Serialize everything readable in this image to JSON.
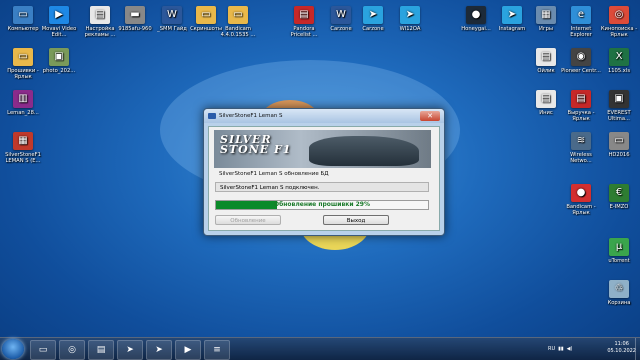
{
  "desktop_icons": [
    {
      "label": "Компьютер",
      "icon": "computer-icon",
      "color": "#3a7fc4",
      "glyph": "▭"
    },
    {
      "label": "Movavi Video Edit...",
      "icon": "movavi-icon",
      "color": "#1e88e5",
      "glyph": "▶"
    },
    {
      "label": "Настройка рекламы ...",
      "icon": "document-icon",
      "color": "#e8e8e8",
      "glyph": "▤"
    },
    {
      "label": "9185afu-960",
      "icon": "usb-icon",
      "color": "#888888",
      "glyph": "▬"
    },
    {
      "label": "_SMM Гайд",
      "icon": "word-icon",
      "color": "#2b579a",
      "glyph": "W"
    },
    {
      "label": "Скриншоты",
      "icon": "folder-icon",
      "color": "#e9b84a",
      "glyph": "▭"
    },
    {
      "label": "Bandicam 4.4.0.1535 ...",
      "icon": "folder-icon",
      "color": "#e9b84a",
      "glyph": "▭"
    },
    {
      "label": "Pandora Pricelist ...",
      "icon": "pdf-icon",
      "color": "#c62828",
      "glyph": "▤"
    },
    {
      "label": "Carzone",
      "icon": "word-icon",
      "color": "#2b579a",
      "glyph": "W"
    },
    {
      "label": "Carzone",
      "icon": "telegram-icon",
      "color": "#2aa3df",
      "glyph": "➤"
    },
    {
      "label": "WI12OA",
      "icon": "telegram-icon",
      "color": "#2aa3df",
      "glyph": "➤"
    },
    {
      "label": "Honeygai...",
      "icon": "honeygain-icon",
      "color": "#1d2a38",
      "glyph": "●"
    },
    {
      "label": "Instagram",
      "icon": "telegram-icon",
      "color": "#2aa3df",
      "glyph": "➤"
    },
    {
      "label": "Игры",
      "icon": "games-icon",
      "color": "#6a8caf",
      "glyph": "▦"
    },
    {
      "label": "Internet Explorer",
      "icon": "ie-icon",
      "color": "#2f8fd8",
      "glyph": "e"
    },
    {
      "label": "Кинопоиска - Ярлык",
      "icon": "chrome-icon",
      "color": "#dd4b39",
      "glyph": "◎"
    },
    {
      "label": "Прошивки - Ярлык",
      "icon": "folder-icon",
      "color": "#e9b84a",
      "glyph": "▭"
    },
    {
      "label": "photo_202...",
      "icon": "image-icon",
      "color": "#7a9a5a",
      "glyph": "▣"
    },
    {
      "label": "Ойлик",
      "icon": "document-icon",
      "color": "#e8e8e8",
      "glyph": "▤"
    },
    {
      "label": "Pioneer Centr...",
      "icon": "pioneer-icon",
      "color": "#444444",
      "glyph": "◉"
    },
    {
      "label": "1105.xls",
      "icon": "excel-icon",
      "color": "#1f7244",
      "glyph": "X"
    },
    {
      "label": "Leman_28...",
      "icon": "winrar-icon",
      "color": "#8b2b8b",
      "glyph": "▥"
    },
    {
      "label": "Инис",
      "icon": "document-icon",
      "color": "#e8e8e8",
      "glyph": "▤"
    },
    {
      "label": "Выручка - Ярлык",
      "icon": "pdf-icon",
      "color": "#c62828",
      "glyph": "▤"
    },
    {
      "label": "EVEREST Ultima...",
      "icon": "everest-icon",
      "color": "#333333",
      "glyph": "▣"
    },
    {
      "label": "SilverStoneF1 LEMAN S (E...",
      "icon": "silverstone-icon",
      "color": "#c0392b",
      "glyph": "▦"
    },
    {
      "label": "Wireless Netwo...",
      "icon": "wireless-icon",
      "color": "#4a6a8a",
      "glyph": "≋"
    },
    {
      "label": "HD2016",
      "icon": "hd-icon",
      "color": "#888888",
      "glyph": "▭"
    },
    {
      "label": "Bandicam - Ярлык",
      "icon": "bandicam-icon",
      "color": "#d32f2f",
      "glyph": "●"
    },
    {
      "label": "E-IMZO",
      "icon": "eimzo-icon",
      "color": "#2e7d32",
      "glyph": "€"
    },
    {
      "label": "uTorrent",
      "icon": "utorrent-icon",
      "color": "#3aa54c",
      "glyph": "µ"
    },
    {
      "label": "Корзина",
      "icon": "recycle-bin-icon",
      "color": "#8fb0c8",
      "glyph": "♲"
    }
  ],
  "window": {
    "title": "SilverStoneF1 Leman S",
    "close": "✕",
    "banner_logo_line1": "SILVER",
    "banner_logo_line2": "STONE F1",
    "db_label": "SilverStoneF1 Leman S обновление БД",
    "status": "SilverStoneF1 Leman S подключен.",
    "progress_text": "Обновление прошивки 29%",
    "progress_fraction": 0.29,
    "update_button": "Обновление",
    "exit_button": "Выход"
  },
  "taskbar": {
    "pinned": [
      {
        "icon": "explorer-icon",
        "glyph": "▭"
      },
      {
        "icon": "chrome-icon",
        "glyph": "◎"
      },
      {
        "icon": "document-icon",
        "glyph": "▤"
      },
      {
        "icon": "telegram-icon",
        "glyph": "➤"
      },
      {
        "icon": "telegram-icon",
        "glyph": "➤"
      },
      {
        "icon": "media-player-icon",
        "glyph": "▶"
      },
      {
        "icon": "silverstone-app-icon",
        "glyph": "≡"
      }
    ],
    "time": "11:06",
    "date": "05.10.2022",
    "lang": "RU"
  }
}
